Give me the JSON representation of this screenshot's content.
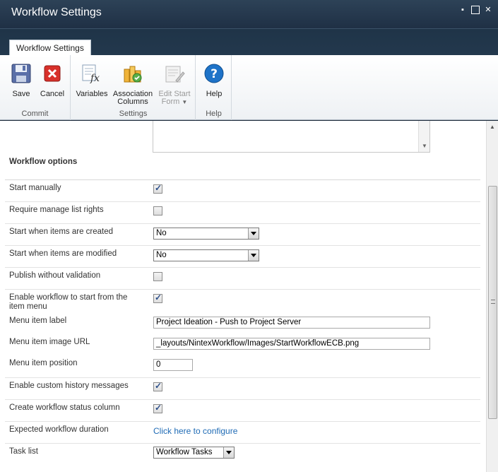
{
  "window": {
    "title": "Workflow Settings",
    "min_label": "▪",
    "max_label": "",
    "close_label": "✕"
  },
  "ribbon": {
    "tab": "Workflow Settings",
    "groups": {
      "commit": {
        "label": "Commit",
        "save": "Save",
        "cancel": "Cancel"
      },
      "settings": {
        "label": "Settings",
        "variables": "Variables",
        "assoc1": "Association",
        "assoc2": "Columns",
        "edit1": "Edit Start",
        "edit2": "Form"
      },
      "help": {
        "label": "Help",
        "help": "Help"
      }
    }
  },
  "section": {
    "title": "Workflow options"
  },
  "rows": {
    "start_manually": {
      "label": "Start manually",
      "checked": true
    },
    "require_rights": {
      "label": "Require manage list rights",
      "checked": false
    },
    "start_created": {
      "label": "Start when items are created",
      "value": "No"
    },
    "start_modified": {
      "label": "Start when items are modified",
      "value": "No"
    },
    "publish_novalid": {
      "label": "Publish without validation",
      "checked": false
    },
    "enable_menu": {
      "label": "Enable workflow to start from the item menu",
      "checked": true
    },
    "menu_label": {
      "label": "Menu item label",
      "value": "Project Ideation - Push to Project Server"
    },
    "menu_image": {
      "label": "Menu item image URL",
      "value": "_layouts/NintexWorkflow/Images/StartWorkflowECB.png"
    },
    "menu_position": {
      "label": "Menu item position",
      "value": "0"
    },
    "custom_history": {
      "label": "Enable custom history messages",
      "checked": true
    },
    "status_column": {
      "label": "Create workflow status column",
      "checked": true
    },
    "duration": {
      "label": "Expected workflow duration",
      "link": "Click here to configure"
    },
    "task_list": {
      "label": "Task list",
      "value": "Workflow Tasks"
    }
  },
  "colors": {
    "titlebar": "#23374c",
    "link": "#1f6bb5",
    "help_icon": "#1e73c8"
  }
}
